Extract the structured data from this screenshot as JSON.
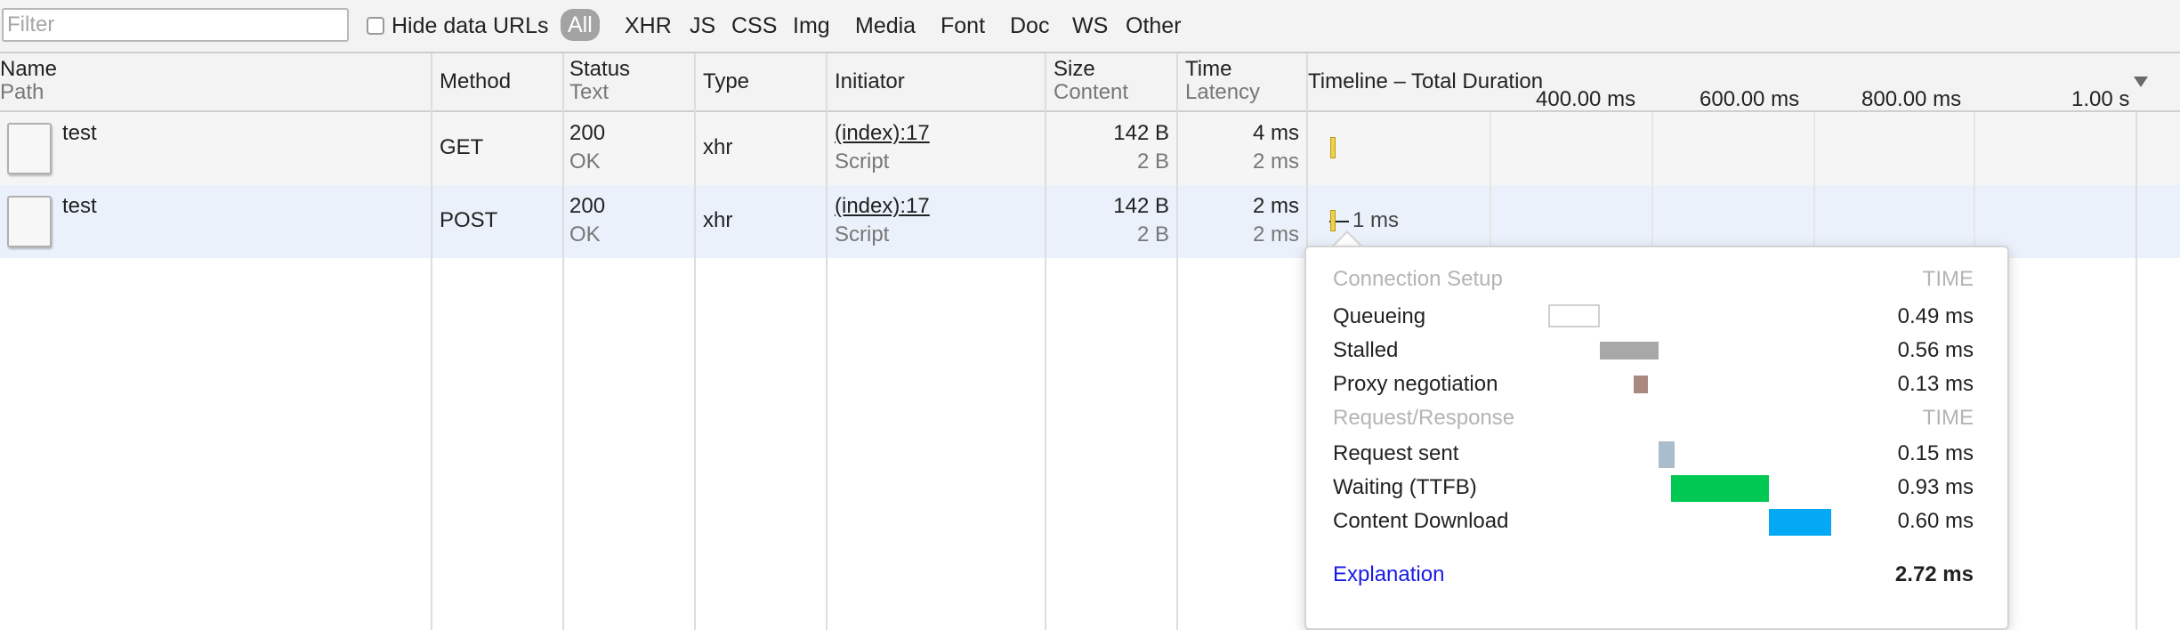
{
  "toolbar": {
    "filter_placeholder": "Filter",
    "hide_data_urls_label": "Hide data URLs",
    "types": [
      "All",
      "XHR",
      "JS",
      "CSS",
      "Img",
      "Media",
      "Font",
      "Doc",
      "WS",
      "Other"
    ]
  },
  "header": {
    "name": "Name",
    "path": "Path",
    "method": "Method",
    "status": "Status",
    "status_text": "Text",
    "type": "Type",
    "initiator": "Initiator",
    "size": "Size",
    "content": "Content",
    "time": "Time",
    "latency": "Latency",
    "timeline": "Timeline – Total Duration",
    "ticks": [
      "400.00 ms",
      "600.00 ms",
      "800.00 ms",
      "1.00 s"
    ]
  },
  "requests": [
    {
      "name": "test",
      "method": "GET",
      "status": "200",
      "status_text": "OK",
      "type": "xhr",
      "initiator": "(index):17",
      "initiator_type": "Script",
      "size": "142 B",
      "content": "2 B",
      "time": "4 ms",
      "latency": "2 ms"
    },
    {
      "name": "test",
      "method": "POST",
      "status": "200",
      "status_text": "OK",
      "type": "xhr",
      "initiator": "(index):17",
      "initiator_type": "Script",
      "size": "142 B",
      "content": "2 B",
      "time": "2 ms",
      "latency": "2 ms",
      "duration_label": "1 ms"
    }
  ],
  "timing": {
    "connection_setup": "Connection Setup",
    "request_response": "Request/Response",
    "time_header": "TIME",
    "rows": [
      {
        "label": "Queueing",
        "value": "0.49 ms",
        "color": "#ffffff"
      },
      {
        "label": "Stalled",
        "value": "0.56 ms",
        "color": "#a8a8a8"
      },
      {
        "label": "Proxy negotiation",
        "value": "0.13 ms",
        "color": "#a88a80"
      },
      {
        "label": "Request sent",
        "value": "0.15 ms",
        "color": "#a9bdcc"
      },
      {
        "label": "Waiting (TTFB)",
        "value": "0.93 ms",
        "color": "#00c853"
      },
      {
        "label": "Content Download",
        "value": "0.60 ms",
        "color": "#03a9f4"
      }
    ],
    "explanation": "Explanation",
    "total": "2.72 ms"
  }
}
